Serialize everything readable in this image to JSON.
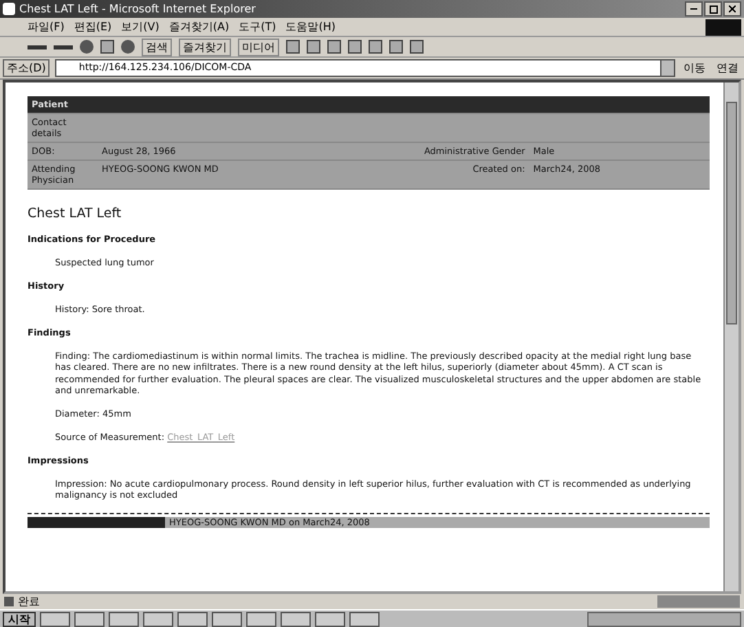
{
  "window": {
    "title": "Chest LAT Left - Microsoft Internet Explorer"
  },
  "menu": [
    "파일(F)",
    "편집(E)",
    "보기(V)",
    "즐겨찾기(A)",
    "도구(T)",
    "도움말(H)"
  ],
  "toolbar": {
    "search": "검색",
    "favorites": "즐겨찾기",
    "media": "미디어"
  },
  "address": {
    "label": "주소(D)",
    "value": "http://164.125.234.106/DICOM-CDA",
    "go": "이동",
    "links": "연결"
  },
  "header_table": {
    "header": "Patient",
    "rows": [
      {
        "label": "Contact details",
        "value": "",
        "label_2": "",
        "value_2": ""
      },
      {
        "label": "DOB:",
        "value": "August 28, 1966",
        "label_2": "Administrative Gender",
        "value_2": "Male"
      },
      {
        "label": "Attending Physician",
        "value": "HYEOG-SOONG KWON MD",
        "label_2": "Created on:",
        "value_2": "March24, 2008"
      }
    ]
  },
  "document": {
    "title": "Chest LAT Left",
    "sections": [
      {
        "heading": "Indications for Procedure",
        "paragraphs": [
          {
            "text": "Suspected lung tumor"
          }
        ]
      },
      {
        "heading": "History",
        "paragraphs": [
          {
            "text": "History: Sore throat."
          }
        ]
      },
      {
        "heading": "Findings",
        "paragraphs": [
          {
            "text": "Finding: The cardiomediastinum is within normal limits. The trachea is midline. The previously described opacity at the medial right lung base has cleared. There are no new infiltrates. There is a new round density at the left hilus, superiorly (diameter about 45mm). A CT scan is recommended for further evaluation. The pleural spaces are clear. The visualized musculoskeletal structures and the upper abdomen are stable and unremarkable."
          },
          {
            "text": "Diameter: 45mm"
          },
          {
            "text": "Source of Measurement: ",
            "link": "Chest_LAT_Left"
          }
        ]
      },
      {
        "heading": "Impressions",
        "paragraphs": [
          {
            "text": "Impression: No acute cardiopulmonary process. Round density in left superior hilus, further evaluation with CT is recommended as underlying malignancy is not excluded"
          }
        ]
      }
    ],
    "footer": "HYEOG-SOONG KWON MD on March24, 2008"
  },
  "status_bar": {
    "text": "완료"
  },
  "taskbar": {
    "start": "시작"
  }
}
